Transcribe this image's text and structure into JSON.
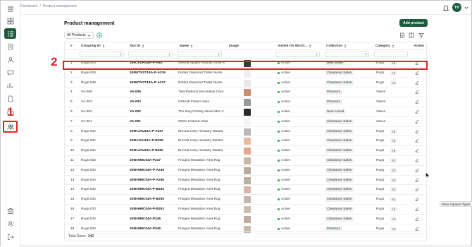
{
  "breadcrumb": [
    "Dashboard",
    "/",
    "Product management"
  ],
  "user": {
    "initials": "TH"
  },
  "page": {
    "title": "Product management",
    "add_button": "Add product"
  },
  "toolbar": {
    "filter_select": "All Products"
  },
  "columns": [
    "#",
    "Grouping ID",
    "Sku ID",
    "Name",
    "Image",
    "Visible On WizOr...",
    "Collection",
    "Category",
    "Action"
  ],
  "rows": [
    {
      "n": "1",
      "group": "Rugs-010",
      "sku": "200CFDRO8A-P-A80",
      "name": "Alessia Splash Abstract Area R",
      "img": "#3a3a3a",
      "visible": "Active",
      "collection": "Best Seller",
      "category": "Rugs",
      "extra": "+1"
    },
    {
      "n": "2",
      "group": "Rugs-028",
      "sku": "200MTVST18A-P-A219",
      "name": "Dotted Diamond Trellis Nurse",
      "img": "#eeeeee",
      "visible": "Active",
      "collection": "Clearance Sales",
      "category": "Rugs",
      "extra": "+1"
    },
    {
      "n": "3",
      "group": "Rugs-028",
      "sku": "200MTVST18A-P-A217",
      "name": "Dotted Diamond Trellis Nurse",
      "img": "#e8e8e8",
      "visible": "Active",
      "collection": "Clearance Sales",
      "category": "Rugs",
      "extra": "+1"
    },
    {
      "n": "4",
      "group": "VA-008",
      "sku": "VA-008",
      "name": "Tied Ribbons Decorative Cera",
      "img": "#c98f73",
      "visible": "Active",
      "collection": "Premium",
      "category": "Vases",
      "extra": ""
    },
    {
      "n": "5",
      "group": "VA-003",
      "sku": "VA-003",
      "name": "Farkraft Flower Vase",
      "img": "#9a9a9a",
      "visible": "Active",
      "collection": "Premium",
      "category": "Vases",
      "extra": ""
    },
    {
      "n": "6",
      "group": "VA-002",
      "sku": "VA-002",
      "name": "The Mug Factory Wood Mini V",
      "img": "#2a2a2a",
      "visible": "Active",
      "collection": "New Arrival",
      "category": "Vases",
      "extra": ""
    },
    {
      "n": "7",
      "group": "VA-001",
      "sku": "VA-001",
      "name": "White Colored Vase",
      "img": "#f4f4f4",
      "visible": "Active",
      "collection": "Clearance Sales",
      "category": "Vases",
      "extra": ""
    },
    {
      "n": "8",
      "group": "Rugs-034",
      "sku": "200HJAU13A-P-A257",
      "name": "Brenda Hazy Heraldry Washa",
      "img": "#b8b8b8",
      "visible": "Active",
      "collection": "Clearance Sales",
      "category": "Rugs",
      "extra": "+1"
    },
    {
      "n": "9",
      "group": "Rugs-034",
      "sku": "200HJAU13A-P-B259",
      "name": "Brenda Hazy Heraldry Washa",
      "img": "#e9b9a0",
      "visible": "Active",
      "collection": "Clearance Sales",
      "category": "Rugs",
      "extra": "+1"
    },
    {
      "n": "10",
      "group": "Rugs-034",
      "sku": "200HJAU13A-P-B260",
      "name": "Brenda Hazy Heraldry Washa",
      "img": "#e3a98f",
      "visible": "Active",
      "collection": "Clearance Sales",
      "category": "Rugs",
      "extra": "+1"
    },
    {
      "n": "11",
      "group": "Rugs-033",
      "sku": "200KHMC04A-P247",
      "name": "Fringed Medallion Area Rug",
      "img": "#c7b8a8",
      "visible": "Active",
      "collection": "Clearance Sales",
      "category": "Rugs",
      "extra": "+1"
    },
    {
      "n": "12",
      "group": "Rugs-033",
      "sku": "200KHMC04A-P-A249",
      "name": "Fringed Medallion Area Rug",
      "img": "#b8aa9c",
      "visible": "Active",
      "collection": "Clearance Sales",
      "category": "Rugs",
      "extra": "+1"
    },
    {
      "n": "13",
      "group": "Rugs-033",
      "sku": "200KHMC04A-P-A250",
      "name": "Fringed Medallion Area Rug",
      "img": "#bdb0a2",
      "visible": "Active",
      "collection": "Clearance Sales",
      "category": "Rugs",
      "extra": "+1"
    },
    {
      "n": "14",
      "group": "Rugs-033",
      "sku": "200KHMC04A-P-B252",
      "name": "Fringed Medallion Area Rug",
      "img": "#d8b6a6",
      "visible": "Active",
      "collection": "Clearance Sales",
      "category": "Rugs",
      "extra": "+1"
    },
    {
      "n": "15",
      "group": "Rugs-033",
      "sku": "200KHMC04A-P-B250",
      "name": "Fringed Medallion Area Rug",
      "img": "#c4b6a8",
      "visible": "Active",
      "collection": "Clearance Sales",
      "category": "Rugs",
      "extra": "+1"
    },
    {
      "n": "16",
      "group": "Rugs-033",
      "sku": "200KHMC04A-P-B251",
      "name": "Fringed Medallion Area Rug",
      "img": "#cbbdaf",
      "visible": "Active",
      "collection": "Clearance Sales",
      "category": "Rugs",
      "extra": "+1"
    },
    {
      "n": "17",
      "group": "Rugs-033",
      "sku": "200KHMC04A-P245",
      "name": "Fringed Medallion Area Rug",
      "img": "#bfae9f",
      "visible": "Active",
      "collection": "Clearance Sales",
      "category": "Rugs",
      "extra": "+1"
    },
    {
      "n": "18",
      "group": "Rugs-033",
      "sku": "200KHMC04A-P246",
      "name": "Fringed Medallion Area Rug",
      "img": "#c9b9aa",
      "visible": "Active",
      "collection": "Premium",
      "category": "Rugs",
      "extra": "+1"
    }
  ],
  "footer": {
    "label": "Total Rows:",
    "count": "342"
  },
  "annotations": {
    "rail": "1",
    "row": "2"
  },
  "tooltip": "More Capture Types",
  "colors": {
    "brand": "#1f5a3f",
    "annotation": "#e02424",
    "active_dot": "#2ea05a"
  }
}
